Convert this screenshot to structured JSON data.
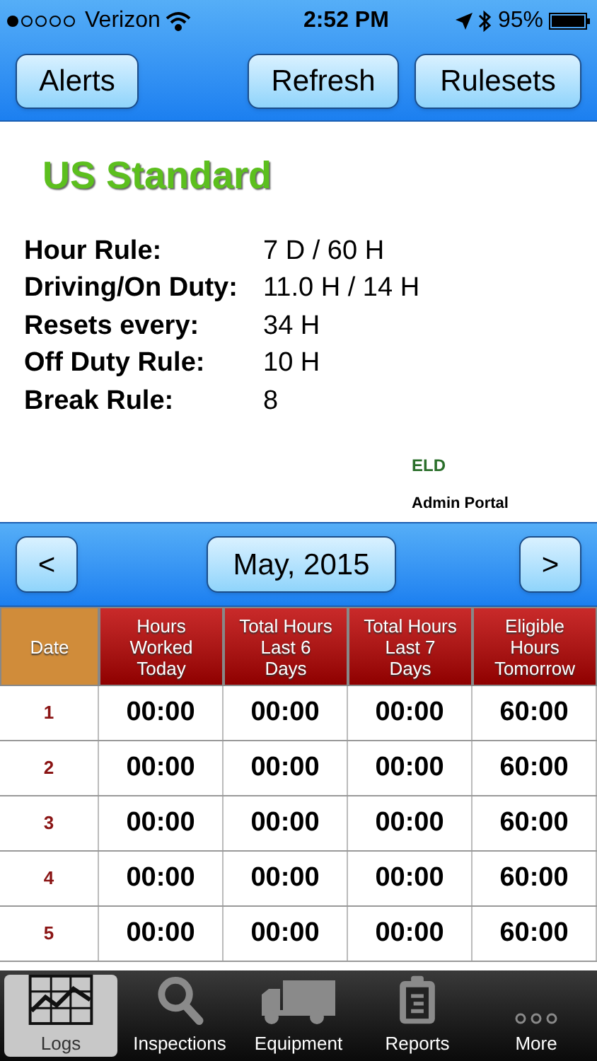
{
  "status_bar": {
    "carrier": "Verizon",
    "time": "2:52 PM",
    "battery": "95%"
  },
  "nav_buttons": [
    "Alerts",
    "Refresh",
    "Rulesets"
  ],
  "ruleset": {
    "title": "US Standard",
    "rules": [
      {
        "label": "Hour Rule:",
        "value": "7 D / 60 H"
      },
      {
        "label": "Driving/On Duty:",
        "value": "11.0 H / 14 H"
      },
      {
        "label": "Resets every:",
        "value": "34 H"
      },
      {
        "label": "Off Duty Rule:",
        "value": "10 H"
      },
      {
        "label": "Break Rule:",
        "value": "8"
      }
    ],
    "link_title": "ELD",
    "link_subtitle": "Admin Portal"
  },
  "month_bar": {
    "prev": "<",
    "month": "May, 2015",
    "next": ">"
  },
  "table": {
    "columns": [
      {
        "label": "Date",
        "kind": "date"
      },
      {
        "label": "Hours Worked Today",
        "kind": "hours"
      },
      {
        "label": "Total Hours Last 6 Days",
        "kind": "hours"
      },
      {
        "label": "Total Hours Last 7 Days",
        "kind": "hours"
      },
      {
        "label": "Eligible Hours Tomorrow",
        "kind": "hours"
      }
    ],
    "rows": [
      [
        "1",
        "00:00",
        "00:00",
        "00:00",
        "60:00"
      ],
      [
        "2",
        "00:00",
        "00:00",
        "00:00",
        "60:00"
      ],
      [
        "3",
        "00:00",
        "00:00",
        "00:00",
        "60:00"
      ],
      [
        "4",
        "00:00",
        "00:00",
        "00:00",
        "60:00"
      ],
      [
        "5",
        "00:00",
        "00:00",
        "00:00",
        "60:00"
      ]
    ]
  },
  "tab_bar": [
    {
      "label": "Logs",
      "selected": true
    },
    {
      "label": "Inspections",
      "selected": false
    },
    {
      "label": "Equipment",
      "selected": false
    },
    {
      "label": "Reports",
      "selected": false
    },
    {
      "label": "More",
      "selected": false
    }
  ]
}
